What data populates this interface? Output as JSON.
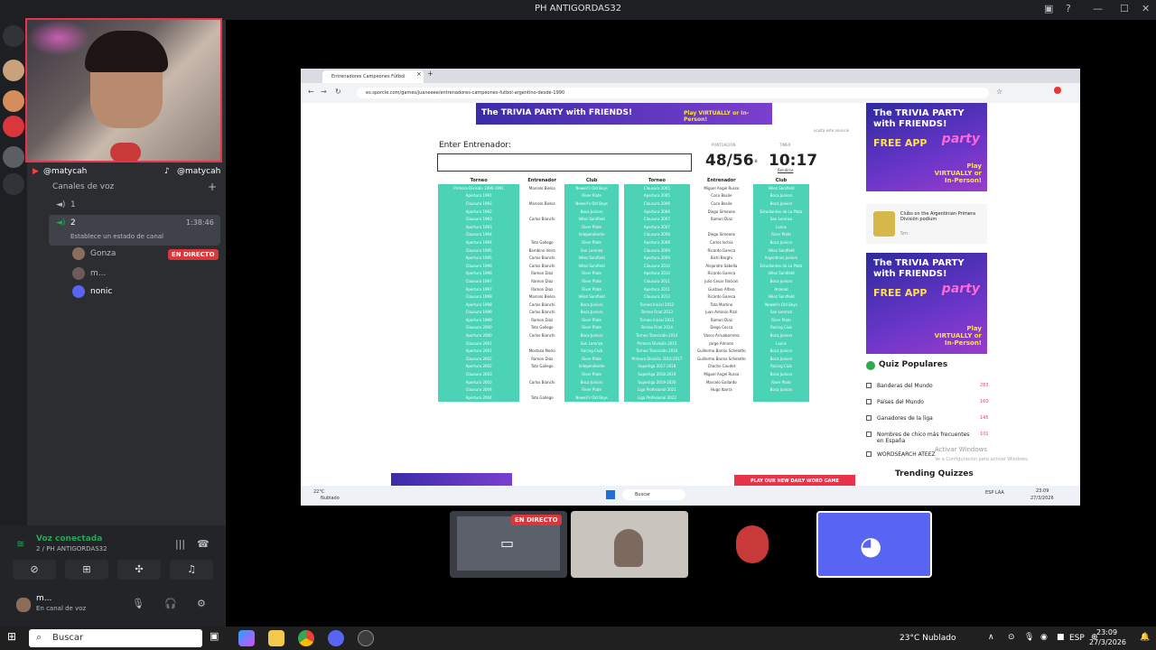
{
  "window": {
    "title": "PH ANTIGORDAS32"
  },
  "streamer": {
    "youtube_handle": "@matycah",
    "tiktok_handle": "@matycah"
  },
  "sidebar": {
    "voice_channels_label": "Canales de voz",
    "channel_1": "1",
    "channel_2": "2",
    "channel_2_time": "1:38:46",
    "channel_2_status": "Establece un estado de canal",
    "users": [
      {
        "name": "Gonza",
        "badge": "EN DIRECTO"
      },
      {
        "name": "m..."
      },
      {
        "name": "nonic"
      }
    ],
    "voice_connected": "Voz conectada",
    "voice_server": "2 / PH ANTIGORDAS32",
    "user_name": "m...",
    "user_status": "En canal de voz"
  },
  "browser": {
    "tab_title": "Entrenadores Campeones Fútbol",
    "url": "es.sporcle.com/games/juaneeee/entrenadores-campeones-futbol-argentino-desde-1990",
    "ad_top": "The TRIVIA PARTY with FRIENDS!",
    "ad_top_cta": "Play VIRTUALLY or In-Person!",
    "hide_ad": "oculta este anuncio",
    "enter_label": "Enter Entrenador:",
    "score_label": "PUNTUACIÓN",
    "score": "48/56",
    "timer_label": "TIMER",
    "timer": "10:17",
    "give_up": "Rendirse",
    "col_torneo": "Torneo",
    "col_entrenador": "Entrenador",
    "col_club": "Club",
    "left_rows": [
      [
        "Primera División 1990-1991",
        "Marcelo Bielsa",
        "Newell's Old Boys"
      ],
      [
        "Apertura 1991",
        "",
        "River Plate"
      ],
      [
        "Clausura 1992",
        "Marcelo Bielsa",
        "Newell's Old Boys"
      ],
      [
        "Apertura 1992",
        "",
        "Boca Juniors"
      ],
      [
        "Clausura 1993",
        "Carlos Bianchi",
        "Vélez Sarsfield"
      ],
      [
        "Apertura 1993",
        "",
        "River Plate"
      ],
      [
        "Clausura 1994",
        "",
        "Independiente"
      ],
      [
        "Apertura 1994",
        "Toto Gallego",
        "River Plate"
      ],
      [
        "Clausura 1995",
        "Bambino Veira",
        "San Lorenzo"
      ],
      [
        "Apertura 1995",
        "Carlos Bianchi",
        "Vélez Sarsfield"
      ],
      [
        "Clausura 1996",
        "Carlos Bianchi",
        "Vélez Sarsfield"
      ],
      [
        "Apertura 1996",
        "Ramon Diaz",
        "River Plate"
      ],
      [
        "Clausura 1997",
        "Ramon Diaz",
        "River Plate"
      ],
      [
        "Apertura 1997",
        "Ramon Diaz",
        "River Plate"
      ],
      [
        "Clausura 1998",
        "Marcelo Bielsa",
        "Vélez Sarsfield"
      ],
      [
        "Apertura 1998",
        "Carlos Bianchi",
        "Boca Juniors"
      ],
      [
        "Clausura 1999",
        "Carlos Bianchi",
        "Boca Juniors"
      ],
      [
        "Apertura 1999",
        "Ramon Diaz",
        "River Plate"
      ],
      [
        "Clausura 2000",
        "Toto Gallego",
        "River Plate"
      ],
      [
        "Apertura 2000",
        "Carlos Bianchi",
        "Boca Juniors"
      ],
      [
        "Clausura 2001",
        "",
        "San Lorenzo"
      ],
      [
        "Apertura 2001",
        "Mostaza Merlo",
        "Racing Club"
      ],
      [
        "Clausura 2002",
        "Ramon Diaz",
        "River Plate"
      ],
      [
        "Apertura 2002",
        "Toto Gallego",
        "Independiente"
      ],
      [
        "Clausura 2003",
        "",
        "River Plate"
      ],
      [
        "Apertura 2003",
        "Carlos Bianchi",
        "Boca Juniors"
      ],
      [
        "Clausura 2004",
        "",
        "River Plate"
      ],
      [
        "Apertura 2004",
        "Toto Gallego",
        "Newell's Old Boys"
      ]
    ],
    "right_rows": [
      [
        "Clausura 2005",
        "Miguel Angel Russo",
        "Vélez Sarsfield"
      ],
      [
        "Apertura 2005",
        "Coco Basile",
        "Boca Juniors"
      ],
      [
        "Clausura 2006",
        "Coco Basile",
        "Boca Juniors"
      ],
      [
        "Apertura 2006",
        "Diego Simeone",
        "Estudiantes de La Plata"
      ],
      [
        "Clausura 2007",
        "Ramon Diaz",
        "San Lorenzo"
      ],
      [
        "Apertura 2007",
        "",
        "Lanús"
      ],
      [
        "Clausura 2008",
        "Diego Simeone",
        "River Plate"
      ],
      [
        "Apertura 2008",
        "Carlos Ischia",
        "Boca Juniors"
      ],
      [
        "Clausura 2009",
        "Ricardo Gareca",
        "Vélez Sarsfield"
      ],
      [
        "Apertura 2009",
        "Bichi Borghi",
        "Argentinos Juniors"
      ],
      [
        "Clausura 2010",
        "Alejandro Sabella",
        "Estudiantes de La Plata"
      ],
      [
        "Apertura 2010",
        "Ricardo Gareca",
        "Vélez Sarsfield"
      ],
      [
        "Clausura 2011",
        "Julio Cesar Falcioni",
        "Boca Juniors"
      ],
      [
        "Apertura 2011",
        "Gustavo Alfaro",
        "Arsenal"
      ],
      [
        "Clausura 2012",
        "Ricardo Gareca",
        "Vélez Sarsfield"
      ],
      [
        "Torneo Inicial 2012",
        "Tata Martino",
        "Newell's Old Boys"
      ],
      [
        "Torneo Final 2013",
        "Juan Antonio Pizzi",
        "San Lorenzo"
      ],
      [
        "Torneo Inicial 2013",
        "Ramon Diaz",
        "River Plate"
      ],
      [
        "Torneo Final 2014",
        "Diego Cocca",
        "Racing Club"
      ],
      [
        "Torneo Transición 2014",
        "Vasco Arruabarrena",
        "Boca Juniors"
      ],
      [
        "Primera División 2015",
        "Jorge Almiron",
        "Lanús"
      ],
      [
        "Torneo Transición 2016",
        "Guillermo Barros Schelotto",
        "Boca Juniors"
      ],
      [
        "Primera División 2016-2017",
        "Guillermo Barros Schelotto",
        "Boca Juniors"
      ],
      [
        "Superliga 2017-2018",
        "Chacho Coudet",
        "Racing Club"
      ],
      [
        "Superliga 2018-2019",
        "Miguel Angel Russo",
        "Boca Juniors"
      ],
      [
        "Superliga 2019-2020",
        "Marcelo Gallardo",
        "River Plate"
      ],
      [
        "Liga Profesional 2021",
        "Hugo Ibarra",
        "Boca Juniors"
      ],
      [
        "Liga Profesional 2022",
        "",
        ""
      ]
    ],
    "ad_side_1": {
      "t1": "The TRIVIA PARTY with FRIENDS!",
      "t2": "FREE APP",
      "brand": "sporcle",
      "party": "party",
      "cta": "Play VIRTUALLY or In-Person!"
    },
    "lpf_text": "Clubs on the Argentinian Primera División podium",
    "lpf_meta": "5m",
    "popular_title": "Quiz Populares",
    "popular_items": [
      {
        "name": "Banderas del Mundo",
        "count": "283"
      },
      {
        "name": "Países del Mundo",
        "count": "160"
      },
      {
        "name": "Ganadores de la liga",
        "count": "145"
      },
      {
        "name": "Nombres de chico más frecuentes en España",
        "count": "101"
      },
      {
        "name": "WORDSEARCH ATEEZ",
        "count": ""
      }
    ],
    "trending": "Trending Quizzes",
    "activate_windows": "Activar Windows",
    "activate_windows_sub": "Ve a Configuración para activar Windows.",
    "play_word_game": "PLAY OUR NEW DAILY WORD GAME",
    "inner_weather_temp": "22°C",
    "inner_weather": "Nublado",
    "inner_search": "Buscar",
    "inner_lang": "ESP LAA",
    "inner_time": "23:09",
    "inner_date": "27/3/2026"
  },
  "thumbs": {
    "live_badge": "EN DIRECTO"
  },
  "taskbar": {
    "search": "Buscar",
    "weather": "23°C  Nublado",
    "lang": "ESP",
    "time": "23:09",
    "date": "27/3/2026"
  }
}
